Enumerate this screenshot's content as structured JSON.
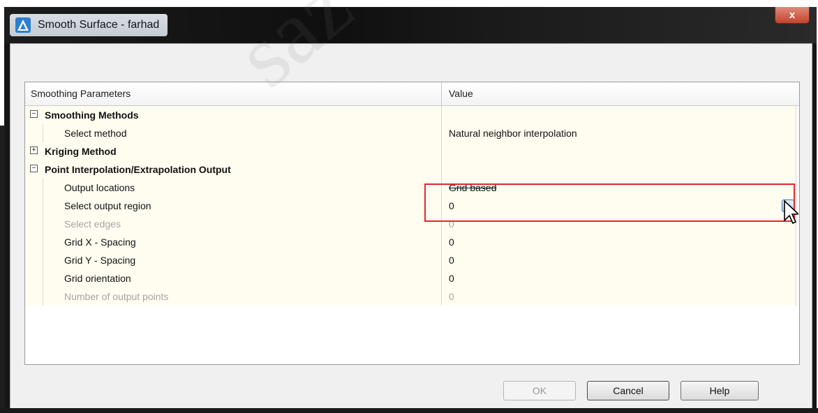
{
  "window": {
    "title": "Smooth Surface - farhad",
    "close_label": "x"
  },
  "grid": {
    "columns": [
      "Smoothing Parameters",
      "Value"
    ],
    "rows": [
      {
        "type": "category",
        "expander": "−",
        "label": "Smoothing Methods",
        "value": ""
      },
      {
        "type": "prop",
        "label": "Select method",
        "value": "Natural neighbor interpolation",
        "disabled": false
      },
      {
        "type": "category",
        "expander": "+",
        "label": "Kriging Method",
        "value": ""
      },
      {
        "type": "category",
        "expander": "−",
        "label": "Point Interpolation/Extrapolation Output",
        "value": ""
      },
      {
        "type": "prop",
        "label": "Output locations",
        "value": "Grid based",
        "disabled": false
      },
      {
        "type": "prop",
        "label": "Select output region",
        "value": "0",
        "disabled": false
      },
      {
        "type": "prop",
        "label": "Select edges",
        "value": "0",
        "disabled": true
      },
      {
        "type": "prop",
        "label": "Grid X - Spacing",
        "value": "0",
        "disabled": false
      },
      {
        "type": "prop",
        "label": "Grid Y - Spacing",
        "value": "0",
        "disabled": false
      },
      {
        "type": "prop",
        "label": "Grid orientation",
        "value": "0",
        "disabled": false
      },
      {
        "type": "prop",
        "label": "Number of output points",
        "value": "0",
        "disabled": true
      }
    ],
    "ellipsis_label": "..."
  },
  "buttons": {
    "ok": "OK",
    "cancel": "Cancel",
    "help": "Help"
  },
  "watermark": "saz",
  "colors": {
    "highlight": "#e0282d",
    "value_cell_bg": "#fffdf0"
  }
}
